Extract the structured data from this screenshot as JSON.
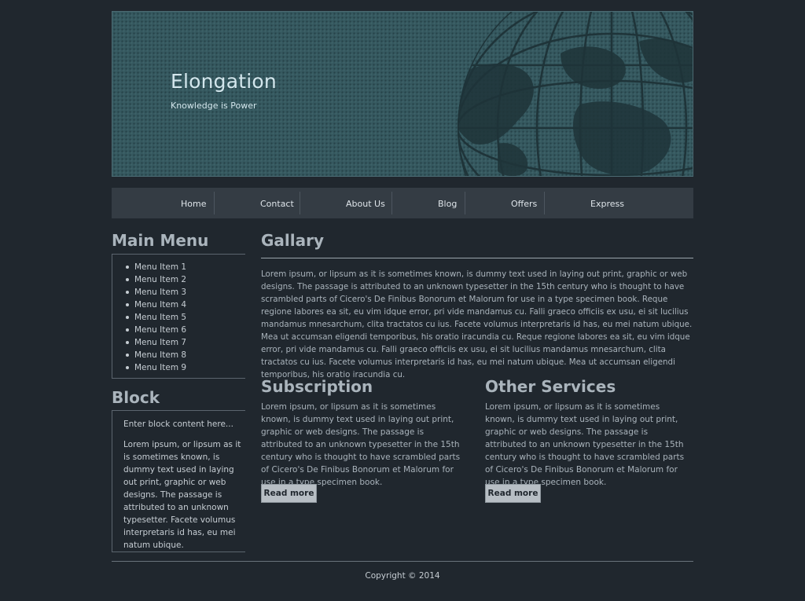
{
  "header": {
    "title": "Elongation",
    "tagline": "Knowledge is Power",
    "colors": {
      "background": "#35585f",
      "title": "#d3e6ec",
      "globe": "#1f3439"
    },
    "art": "globe-illustration"
  },
  "nav": {
    "items": [
      {
        "label": "Home"
      },
      {
        "label": "Contact"
      },
      {
        "label": "About Us"
      },
      {
        "label": "Blog"
      },
      {
        "label": "Offers"
      },
      {
        "label": "Express"
      }
    ]
  },
  "sidebar": {
    "menu_heading": "Main Menu",
    "menu_items": [
      "Menu Item 1",
      "Menu Item 2",
      "Menu Item 3",
      "Menu Item 4",
      "Menu Item 5",
      "Menu Item 6",
      "Menu Item 7",
      "Menu Item 8",
      "Menu Item 9"
    ],
    "block_heading": "Block",
    "block_intro": "Enter block content here...",
    "block_text": "Lorem ipsum, or lipsum as it is sometimes known, is dummy text used in laying out print, graphic or web designs. The passage is attributed to an unknown typesetter. Facete volumus interpretaris id has, eu mei natum ubique."
  },
  "main": {
    "gallery_heading": "Gallary",
    "gallery_text": "Lorem ipsum, or lipsum as it is sometimes known, is dummy text used in laying out print, graphic or web designs. The passage is attributed to an unknown typesetter in the 15th century who is thought to have scrambled parts of Cicero's De Finibus Bonorum et Malorum for use in a type specimen book. Reque regione labores ea sit, eu vim idque error, pri vide mandamus cu. Falli graeco officiis ex usu, ei sit lucilius mandamus mnesarchum, clita tractatos cu ius. Facete volumus interpretaris id has, eu mei natum ubique. Mea ut accumsan eligendi temporibus, his oratio iracundia cu. Reque regione labores ea sit, eu vim idque error, pri vide mandamus cu. Falli graeco officiis ex usu, ei sit lucilius mandamus mnesarchum, clita tractatos cu ius. Facete volumus interpretaris id has, eu mei natum ubique. Mea ut accumsan eligendi temporibus, his oratio iracundia cu.",
    "subscription_heading": "Subscription",
    "subscription_text": "Lorem ipsum, or lipsum as it is sometimes known, is dummy text used in laying out print, graphic or web designs. The passage is attributed to an unknown typesetter in the 15th century who is thought to have scrambled parts of Cicero's De Finibus Bonorum et Malorum for use in a type specimen book.",
    "subscription_button": "Read more",
    "services_heading": "Other Services",
    "services_text": "Lorem ipsum, or lipsum as it is sometimes known, is dummy text used in laying out print, graphic or web designs. The passage is attributed to an unknown typesetter in the 15th century who is thought to have scrambled parts of Cicero's De Finibus Bonorum et Malorum for use in a type specimen book.",
    "services_button": "Read more"
  },
  "footer": {
    "copyright": "Copyright © 2014"
  },
  "theme": {
    "page_bg": "#20272e",
    "nav_bg": "#343c44",
    "heading": "#aab4bc",
    "button_bg": "#b7bec4"
  }
}
